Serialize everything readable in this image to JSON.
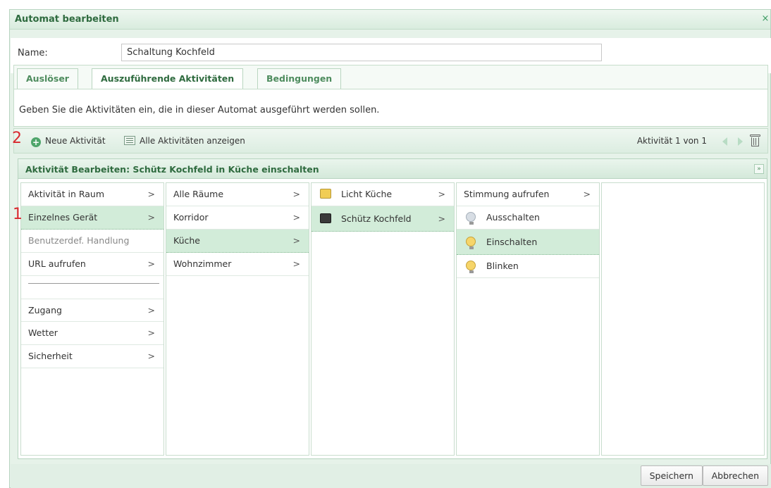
{
  "window": {
    "title": "Automat bearbeiten",
    "close_glyph": "×"
  },
  "name_field": {
    "label": "Name:",
    "value": "Schaltung Kochfeld"
  },
  "tabs": [
    {
      "label": "Auslöser"
    },
    {
      "label": "Auszuführende Aktivitäten"
    },
    {
      "label": "Bedingungen"
    }
  ],
  "info_text": "Geben Sie die Aktivitäten ein, die in dieser Automat ausgeführt werden sollen.",
  "toolbar": {
    "new_activity": "Neue Aktivität",
    "show_all": "Alle Aktivitäten anzeigen",
    "pager": "Aktivität 1 von 1"
  },
  "edit_panel": {
    "title": "Aktivität Bearbeiten: Schütz Kochfeld in Küche einschalten",
    "collapse_glyph": "»"
  },
  "columns": {
    "col1": [
      {
        "label": "Aktivität in Raum",
        "chevron": ">"
      },
      {
        "label": "Einzelnes Gerät",
        "chevron": ">"
      },
      {
        "label": "Benutzerdef. Handlung",
        "chevron": ""
      },
      {
        "label": "URL aufrufen",
        "chevron": ">"
      },
      {
        "label": "Zugang",
        "chevron": ">"
      },
      {
        "label": "Wetter",
        "chevron": ">"
      },
      {
        "label": "Sicherheit",
        "chevron": ">"
      }
    ],
    "col2": [
      {
        "label": "Alle Räume",
        "chevron": ">"
      },
      {
        "label": "Korridor",
        "chevron": ">"
      },
      {
        "label": "Küche",
        "chevron": ">"
      },
      {
        "label": "Wohnzimmer",
        "chevron": ">"
      }
    ],
    "col3": [
      {
        "label": "Licht Küche",
        "chevron": ">",
        "icon": "light-device-icon"
      },
      {
        "label": "Schütz Kochfeld",
        "chevron": ">",
        "icon": "contactor-device-icon"
      }
    ],
    "col4": [
      {
        "label": "Stimmung aufrufen",
        "chevron": ">"
      },
      {
        "label": "Ausschalten",
        "icon": "bulb-off-icon"
      },
      {
        "label": "Einschalten",
        "icon": "bulb-on-icon"
      },
      {
        "label": "Blinken",
        "icon": "bulb-blink-icon"
      }
    ]
  },
  "markers": {
    "one": "1",
    "two": "2"
  },
  "footer": {
    "save": "Speichern",
    "cancel": "Abbrechen"
  },
  "colors": {
    "accent": "#2f6b3f",
    "selection": "#d2ecd9",
    "marker": "#d8282e"
  }
}
